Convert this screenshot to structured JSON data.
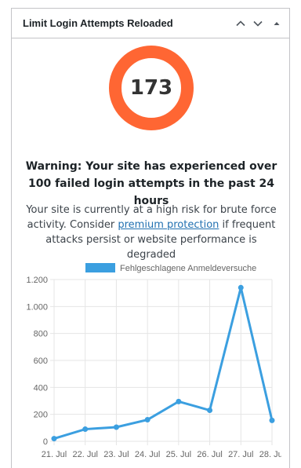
{
  "widget": {
    "title": "Limit Login Attempts Reloaded",
    "controls": [
      "move-up-icon",
      "move-down-icon",
      "toggle-panel-icon"
    ]
  },
  "counter": {
    "value": "173",
    "accent_color": "#ff6633"
  },
  "warning": {
    "text": "Warning: Your site has experienced over 100 failed login attempts in the past 24 hours"
  },
  "description": {
    "before": "Your site is currently at a high risk for brute force activity. Consider ",
    "link": "premium protection",
    "after": " if frequent attacks persist or website performance is degraded"
  },
  "chart_data": {
    "type": "line",
    "categories": [
      "21. Jul",
      "22. Jul",
      "23. Jul",
      "24. Jul",
      "25. Jul",
      "26. Jul",
      "27. Jul",
      "28. Jul"
    ],
    "series": [
      {
        "name": "Fehlgeschlagene Anmeldeversuche",
        "values": [
          20,
          90,
          105,
          160,
          295,
          230,
          1140,
          155
        ],
        "color": "#3b9fe0"
      }
    ],
    "ylim": [
      0,
      1200
    ],
    "yticks": [
      0,
      200,
      400,
      600,
      800,
      1000,
      1200
    ],
    "ytick_labels": [
      "0",
      "200",
      "400",
      "600",
      "800",
      "1.000",
      "1.200"
    ],
    "legend_position": "top",
    "grid": true
  }
}
